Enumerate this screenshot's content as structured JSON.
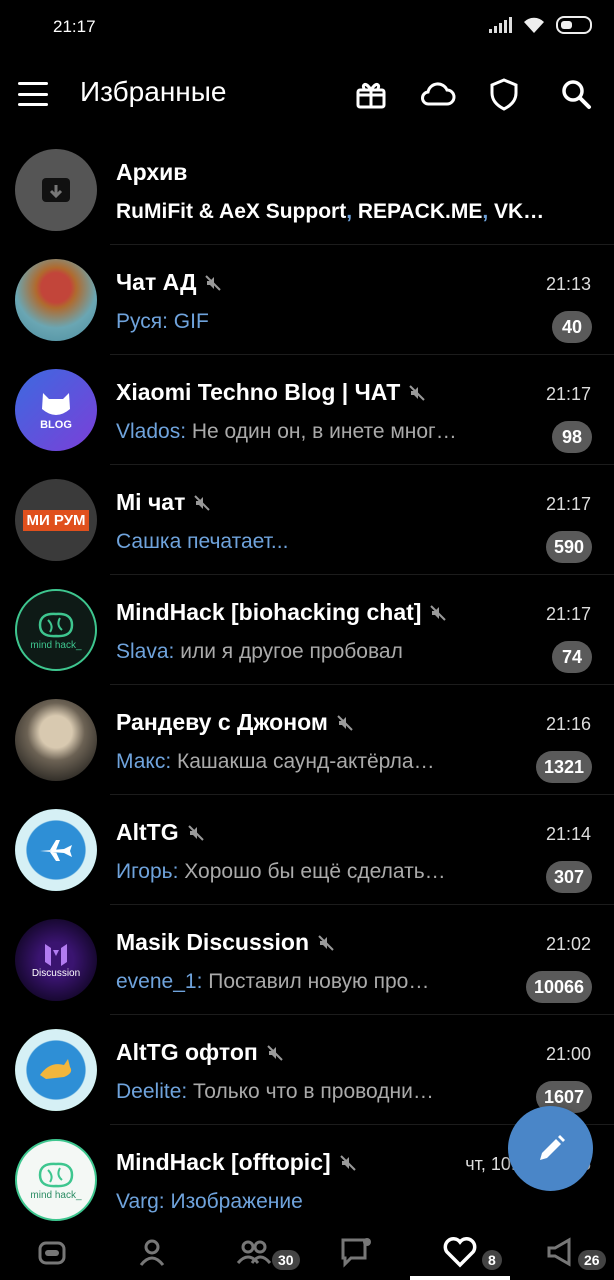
{
  "status_bar": {
    "time": "21:17"
  },
  "header": {
    "title": "Избранные"
  },
  "chats": [
    {
      "name": "Архив",
      "sender": "",
      "preview_html_parts": [
        "RuMiFit & AeX Support",
        ", ",
        "REPACK.ME",
        ", ",
        "VK…"
      ],
      "time": "",
      "unread": "",
      "muted": false
    },
    {
      "name": "Чат АД",
      "sender": "Руся: GIF",
      "preview": "",
      "time": "21:13",
      "unread": "40",
      "muted": true
    },
    {
      "name": "Xiaomi Techno Blog | ЧАТ",
      "sender": "Vlados:",
      "preview": " Не один он, в инете мног…",
      "time": "21:17",
      "unread": "98",
      "muted": true
    },
    {
      "name": "Mi чат",
      "sender": "Сашка печатает...",
      "preview": "",
      "time": "21:17",
      "unread": "590",
      "muted": true
    },
    {
      "name": "MindHack [biohacking chat]",
      "sender": "Slava:",
      "preview": " или я другое пробовал",
      "time": "21:17",
      "unread": "74",
      "muted": true
    },
    {
      "name": "Рандеву с Джоном",
      "sender": "Макс:",
      "preview": " Кашакша саунд-актёрла…",
      "time": "21:16",
      "unread": "1321",
      "muted": true
    },
    {
      "name": "AltTG",
      "sender": "Игорь:",
      "preview": " Хорошо бы ещё сделать…",
      "time": "21:14",
      "unread": "307",
      "muted": true
    },
    {
      "name": "Masik Discussion",
      "sender": "evene_1:",
      "preview": " Поставил новую про…",
      "time": "21:02",
      "unread": "10066",
      "muted": true
    },
    {
      "name": "AltTG офтоп",
      "sender": "Deelite:",
      "preview": " Только что в проводни…",
      "time": "21:00",
      "unread": "1607",
      "muted": true
    },
    {
      "name": "MindHack [offtopic]",
      "sender": "Varg: Изображение",
      "preview": "",
      "time": "чт, 10.10, 14:55",
      "unread": "",
      "muted": true
    }
  ],
  "avatars": {
    "archive": "archive-icon",
    "blog_text": "BLOG",
    "mirum_text": "МИ РУМ",
    "mindhack_text": "mind hack_",
    "discussion_text": "Discussion"
  },
  "bottom_nav": {
    "groups_badge": "30",
    "favorites_badge": "8",
    "channels_badge": "26"
  },
  "colors": {
    "accent": "#4a86c8",
    "sender": "#6fa3dc",
    "badge": "#5a5a5a"
  }
}
